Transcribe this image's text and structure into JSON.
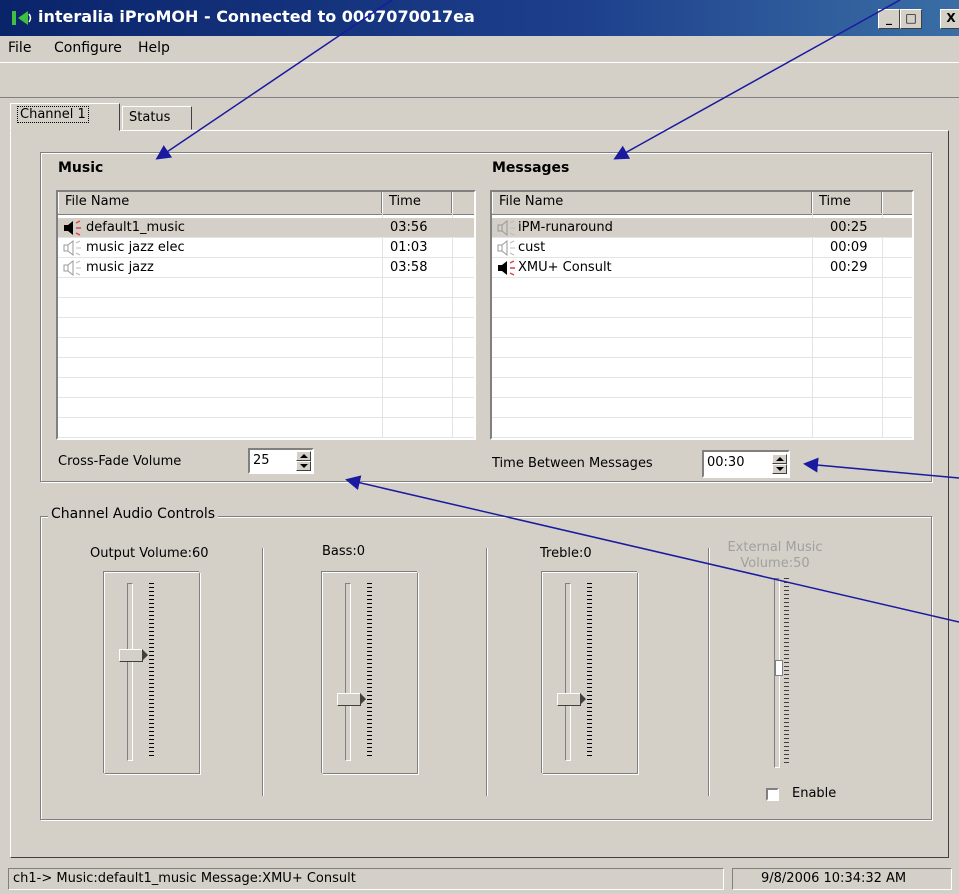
{
  "window": {
    "title": "interalia iProMOH - Connected to 0007070017ea",
    "icon": "app-icon",
    "controls": [
      "_",
      "□",
      "X"
    ]
  },
  "menu": [
    "File",
    "Configure",
    "Help"
  ],
  "tabs": [
    {
      "label": "Channel 1",
      "active": true
    },
    {
      "label": "Status",
      "active": false
    }
  ],
  "music": {
    "title": "Music",
    "columns": [
      "File Name",
      "Time"
    ],
    "rows": [
      {
        "name": "default1_music",
        "time": "03:56",
        "icon": "speaker-playing-icon"
      },
      {
        "name": "music jazz elec",
        "time": "01:03",
        "icon": "speaker-icon"
      },
      {
        "name": "music jazz",
        "time": "03:58",
        "icon": "speaker-icon"
      }
    ]
  },
  "messages": {
    "title": "Messages",
    "columns": [
      "File Name",
      "Time"
    ],
    "rows": [
      {
        "name": "iPM-runaround",
        "time": "00:25",
        "icon": "speaker-icon"
      },
      {
        "name": "cust",
        "time": "00:09",
        "icon": "speaker-icon"
      },
      {
        "name": "XMU+ Consult",
        "time": "00:29",
        "icon": "speaker-playing-icon"
      }
    ]
  },
  "crossfade": {
    "label": "Cross-Fade Volume",
    "value": "25"
  },
  "time_between": {
    "label": "Time Between Messages",
    "value": "00:30"
  },
  "audio": {
    "title": "Channel Audio Controls",
    "sliders": [
      {
        "label": "Output Volume:60",
        "level": 0.6
      },
      {
        "label": "Bass:0",
        "level": 0.5
      },
      {
        "label": "Treble:0",
        "level": 0.5
      }
    ],
    "external": {
      "label_line1": "External Music",
      "label_line2": "Volume:50",
      "level": 0.5,
      "enable_label": "Enable",
      "enabled": false
    }
  },
  "status": {
    "left": "ch1-> Music:default1_music  Message:XMU+ Consult",
    "right": "9/8/2006 10:34:32 AM"
  },
  "colors": {
    "titlebar": "#0a246a",
    "face": "#d4d0c8",
    "annotation_arrow": "#1a1aa0",
    "icon_accent": "#e04040"
  }
}
